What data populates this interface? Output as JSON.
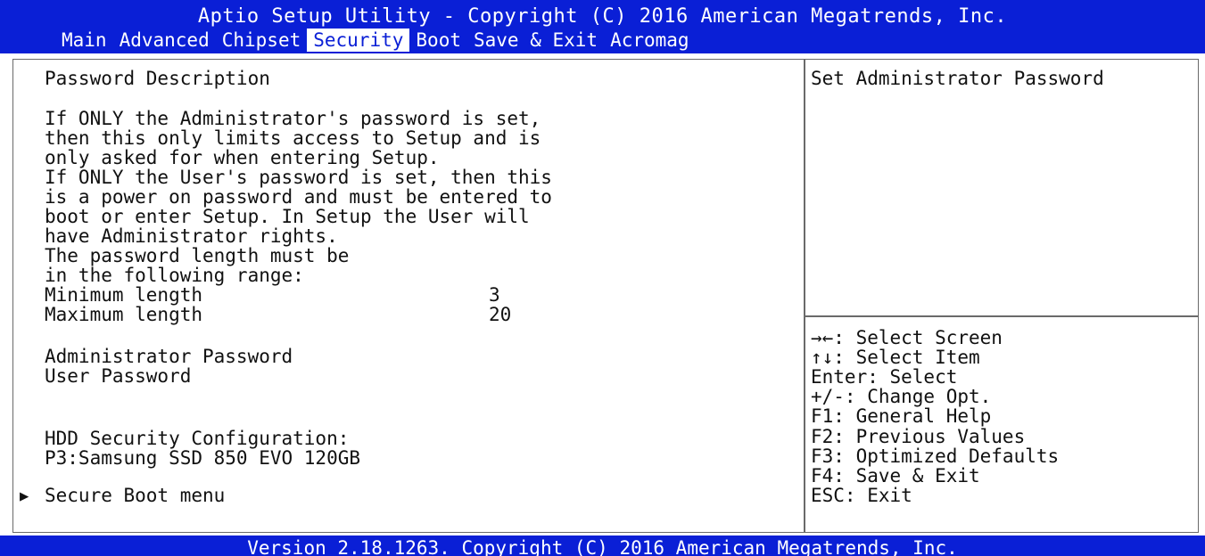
{
  "header": {
    "title": "Aptio Setup Utility - Copyright (C) 2016 American Megatrends, Inc.",
    "tabs": [
      "Main",
      "Advanced",
      "Chipset",
      "Security",
      "Boot",
      "Save & Exit",
      "Acromag"
    ],
    "active_tab": "Security"
  },
  "main": {
    "section_title": "Password Description",
    "description_lines": [
      "If ONLY the Administrator's password is set,",
      "then this only limits access to Setup and is",
      "only asked for when entering Setup.",
      "If ONLY the User's password is set, then this",
      "is a power on password and must be entered to",
      "boot or enter Setup. In Setup the User will",
      "have Administrator rights.",
      "The password length must be",
      "in the following range:"
    ],
    "min_label": "Minimum length",
    "min_value": "3",
    "max_label": "Maximum length",
    "max_value": "20",
    "admin_password_label": "Administrator Password",
    "user_password_label": "User Password",
    "hdd_config_label": "HDD Security Configuration:",
    "hdd_device": "P3:Samsung SSD 850 EVO 120GB",
    "secure_boot_label": "Secure Boot menu"
  },
  "help": {
    "text": "Set Administrator Password",
    "keys": [
      "→←: Select Screen",
      "↑↓: Select Item",
      "Enter: Select",
      "+/-: Change Opt.",
      "F1: General Help",
      "F2: Previous Values",
      "F3: Optimized Defaults",
      "F4: Save & Exit",
      "ESC: Exit"
    ]
  },
  "footer": {
    "text": "Version 2.18.1263. Copyright (C) 2016 American Megatrends, Inc."
  },
  "colors": {
    "bar": "#0a1fd6",
    "text": "#111111",
    "background": "#ffffff"
  },
  "icons": {
    "submenu_pointer": "right-triangle-icon"
  }
}
